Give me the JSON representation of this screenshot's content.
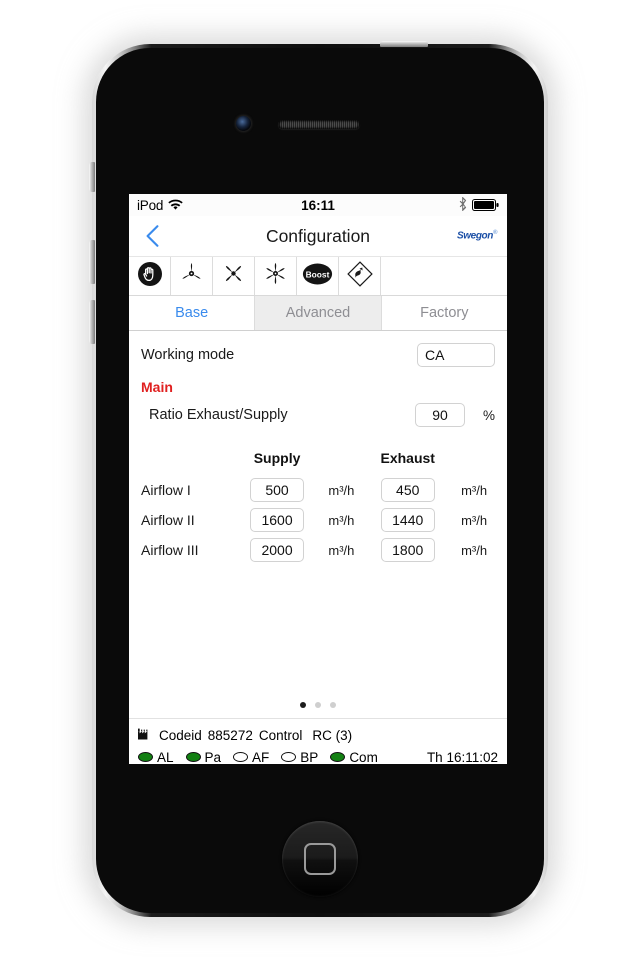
{
  "device": {
    "name": "iphone-4",
    "camera_icon": "front-camera-icon",
    "speaker_icon": "earpiece-speaker-icon",
    "home_button_icon": "home-button-icon"
  },
  "ios_status_bar": {
    "carrier": "iPod",
    "wifi_icon": "wifi-icon",
    "time": "16:11",
    "bluetooth_icon": "bluetooth-icon",
    "battery_icon": "battery-full-icon"
  },
  "nav_bar": {
    "back_icon": "chevron-left-icon",
    "title": "Configuration",
    "brand": "Swegon",
    "brand_mark": "®"
  },
  "mode_toolbar": {
    "buttons": [
      {
        "name": "mode-stop",
        "icon": "hand-stop-icon",
        "label": ""
      },
      {
        "name": "mode-airflow-1",
        "icon": "fan-3-blade-icon",
        "label": ""
      },
      {
        "name": "mode-airflow-2",
        "icon": "fan-4-blade-icon",
        "label": ""
      },
      {
        "name": "mode-airflow-3",
        "icon": "fan-6-blade-icon",
        "label": ""
      },
      {
        "name": "mode-boost",
        "icon": "boost-icon",
        "label": "Boost"
      },
      {
        "name": "mode-bypass",
        "icon": "diamond-flow-icon",
        "label": ""
      }
    ]
  },
  "tabs": [
    {
      "label": "Base",
      "active": true
    },
    {
      "label": "Advanced",
      "active": false
    },
    {
      "label": "Factory",
      "active": false
    }
  ],
  "form": {
    "working_mode": {
      "label": "Working mode",
      "value": "CA"
    },
    "section_main": "Main",
    "ratio": {
      "label": "Ratio Exhaust/Supply",
      "value": "90",
      "unit": "%"
    },
    "airflow_table": {
      "col_label": "",
      "col_supply": "Supply",
      "col_exhaust": "Exhaust",
      "unit": "m³/h",
      "rows": [
        {
          "name": "Airflow I",
          "supply": "500",
          "supply_unit": "m³/h",
          "exhaust": "450",
          "exhaust_unit": "m³/h"
        },
        {
          "name": "Airflow II",
          "supply": "1600",
          "supply_unit": "m³/h",
          "exhaust": "1440",
          "exhaust_unit": "m³/h"
        },
        {
          "name": "Airflow III",
          "supply": "2000",
          "supply_unit": "m³/h",
          "exhaust": "1800",
          "exhaust_unit": "m³/h"
        }
      ]
    }
  },
  "pagination": {
    "dots": 3,
    "active_index": 0
  },
  "footer": {
    "factory_icon": "factory-icon",
    "codeid_label": "Codeid",
    "codeid_value": "885272",
    "control_label": "Control",
    "control_value": "RC (3)",
    "leds": [
      {
        "label": "AL",
        "state": "on"
      },
      {
        "label": "Pa",
        "state": "on"
      },
      {
        "label": "AF",
        "state": "off"
      },
      {
        "label": "BP",
        "state": "off"
      },
      {
        "label": "Com",
        "state": "on"
      }
    ],
    "time": "Th 16:11:02"
  },
  "colors": {
    "accent_blue": "#3a8bed",
    "brand_blue": "#1b4fa6",
    "section_red": "#e02020",
    "led_green": "#128012",
    "tab_inactive": "#8e8e93"
  }
}
